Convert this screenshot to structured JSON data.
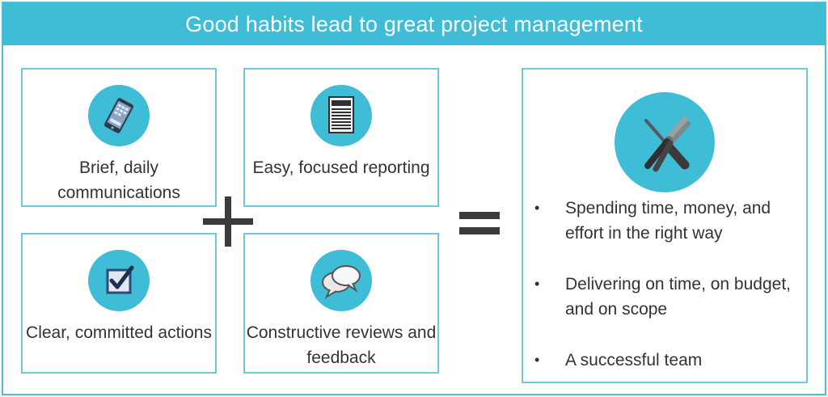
{
  "title": "Good habits lead to great project management",
  "habits": [
    {
      "label": "Brief, daily communications",
      "icon": "smartphone-icon"
    },
    {
      "label": "Easy, focused reporting",
      "icon": "newspaper-icon"
    },
    {
      "label": "Clear, committed actions",
      "icon": "checkbox-icon"
    },
    {
      "label": "Constructive reviews and feedback",
      "icon": "speech-bubbles-icon"
    }
  ],
  "operators": {
    "plus": "+",
    "equals": "="
  },
  "result": {
    "icon": "tools-icon",
    "outcomes": [
      "Spending time, money, and effort in the right way",
      "Delivering on time, on budget, and on scope",
      "A successful team"
    ]
  },
  "colors": {
    "accent": "#3fbcd6",
    "border": "#6fc9dd",
    "text": "#333333",
    "operator": "#3b3b3b"
  }
}
